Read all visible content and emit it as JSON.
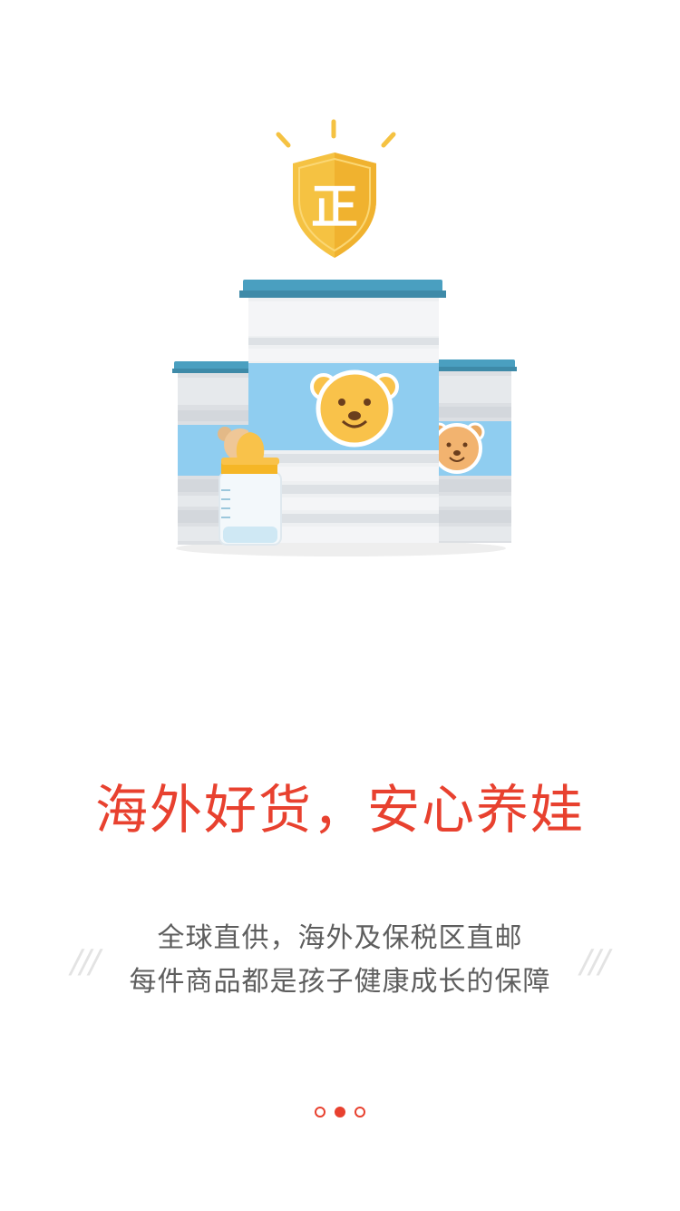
{
  "headline": "海外好货，安心养娃",
  "subtitle": {
    "line1": "全球直供，海外及保税区直邮",
    "line2": "每件商品都是孩子健康成长的保障"
  },
  "badge_text": "正",
  "decorations": {
    "left": "///",
    "right": "///"
  },
  "pagination": {
    "total": 3,
    "active_index": 1
  },
  "colors": {
    "accent": "#e8412f",
    "shield_gold": "#f5c242",
    "can_lid_blue": "#4a9fc0",
    "can_label_blue": "#8fcdf0",
    "bear_face": "#f9c24a",
    "text_gray": "#5e5e5e"
  },
  "icons": [
    "shield-badge-icon",
    "formula-can-icon",
    "bear-face-icon",
    "baby-bottle-icon"
  ]
}
